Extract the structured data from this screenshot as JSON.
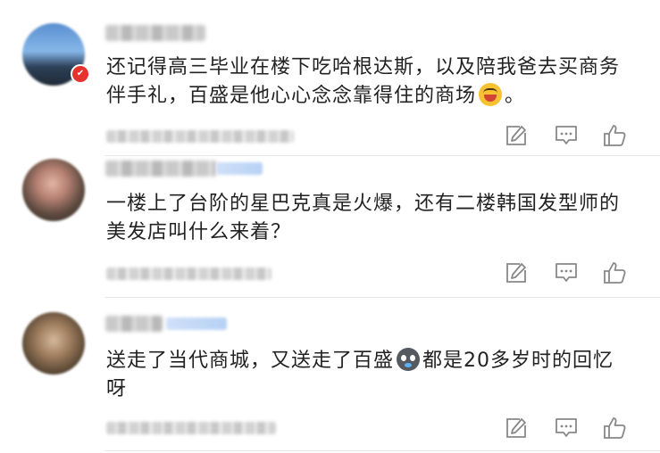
{
  "colors": {
    "text": "#222222",
    "icon": "#888888",
    "divider": "#e8e8e8",
    "badge": "#e5322d"
  },
  "comments": [
    {
      "text": "还记得高三毕业在楼下吃哈根达斯，以及陪我爸去买商务伴手礼，百盛是他心心念念靠得住的商场",
      "text_suffix": "。",
      "emoji": "laughing-face-icon",
      "has_badge": true
    },
    {
      "text": "一楼上了台阶的星巴克真是火爆，还有二楼韩国发型师的美发店叫什么来着？",
      "has_badge": false
    },
    {
      "text": "送走了当代商城，又送走了百盛",
      "text_suffix": "都是20多岁时的回忆呀",
      "emoji": "crying-face-icon",
      "has_badge": false
    }
  ],
  "icons": {
    "share": "share-icon",
    "reply": "comment-icon",
    "like": "thumbs-up-icon"
  }
}
